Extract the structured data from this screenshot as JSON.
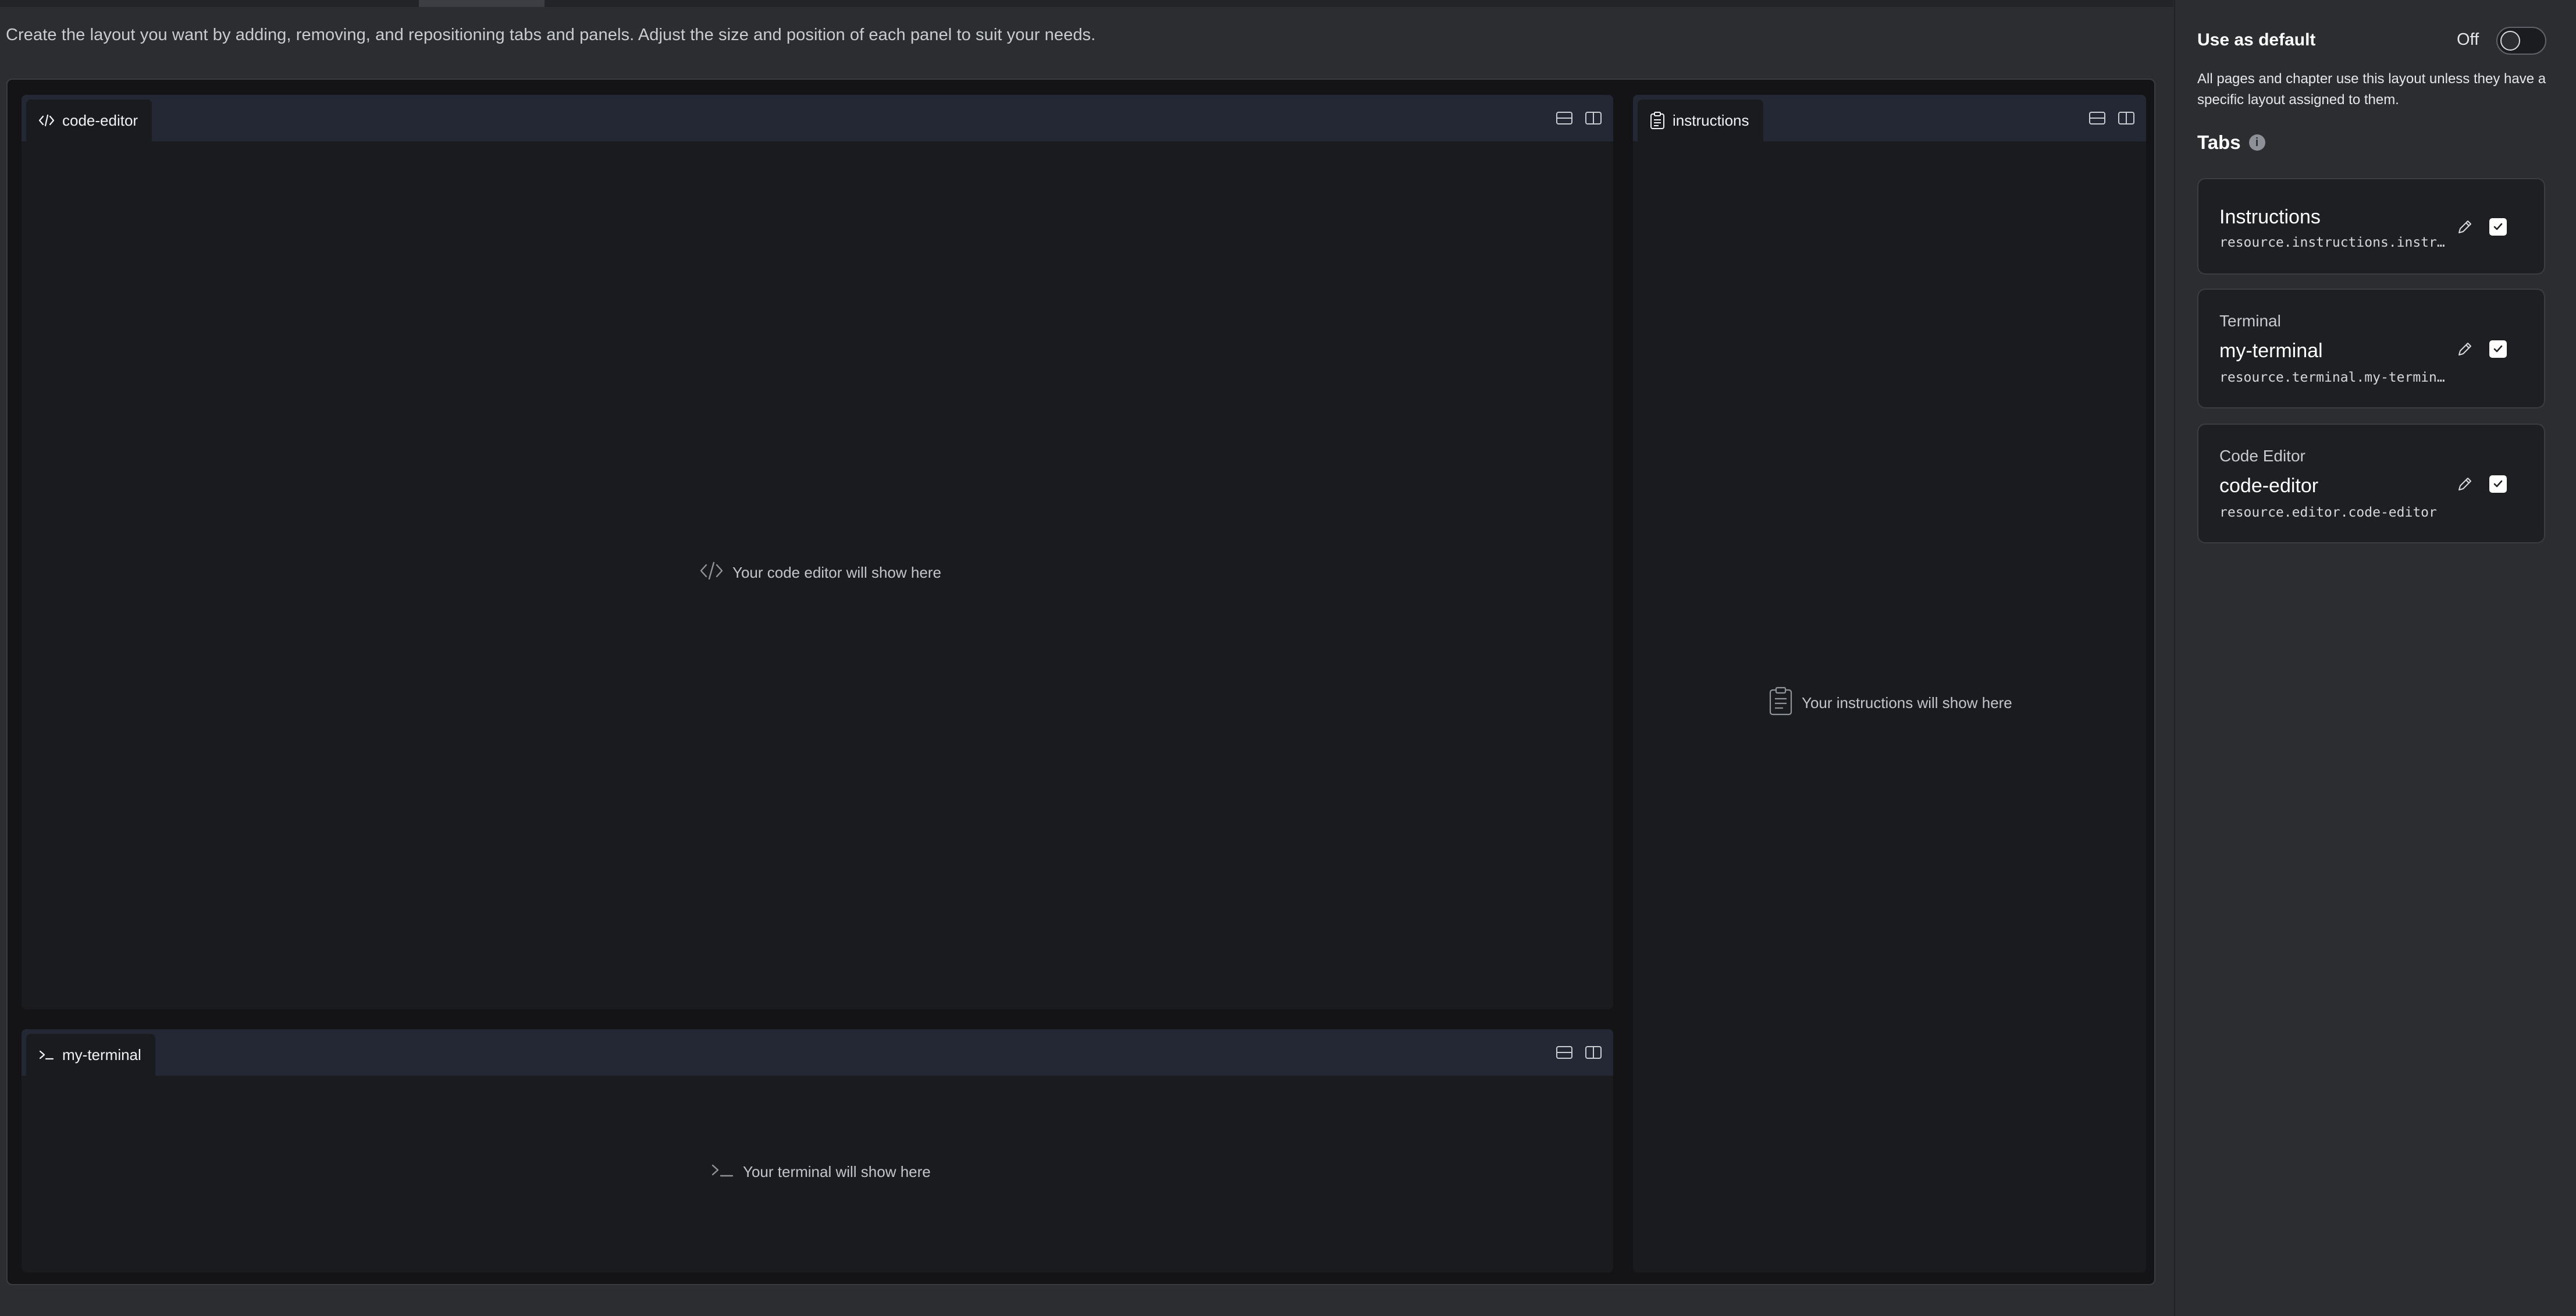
{
  "intro": "Create the layout you want by adding, removing, and repositioning tabs and panels. Adjust the size and position of each panel to suit your needs.",
  "panels": {
    "code_editor": {
      "tab_label": "code-editor",
      "placeholder": "Your code editor will show here",
      "icon": "code-icon"
    },
    "terminal": {
      "tab_label": "my-terminal",
      "placeholder": "Your terminal will show here",
      "icon": "terminal-icon"
    },
    "instructions": {
      "tab_label": "instructions",
      "placeholder": "Your instructions will show here",
      "icon": "clipboard-icon"
    }
  },
  "sidebar": {
    "default_label": "Use as default",
    "toggle_state": "Off",
    "description": "All pages and chapter use this layout unless they have a specific layout assigned to them.",
    "tabs_heading": "Tabs",
    "tabs": [
      {
        "type": "",
        "name": "Instructions",
        "id": "resource.instructions.instructions",
        "checked": true
      },
      {
        "type": "Terminal",
        "name": "my-terminal",
        "id": "resource.terminal.my-terminal",
        "checked": true
      },
      {
        "type": "Code Editor",
        "name": "code-editor",
        "id": "resource.editor.code-editor",
        "checked": true
      }
    ]
  },
  "colors": {
    "background": "#2b2d31",
    "panel": "#1a1b1e",
    "tab_bar": "#232834"
  }
}
